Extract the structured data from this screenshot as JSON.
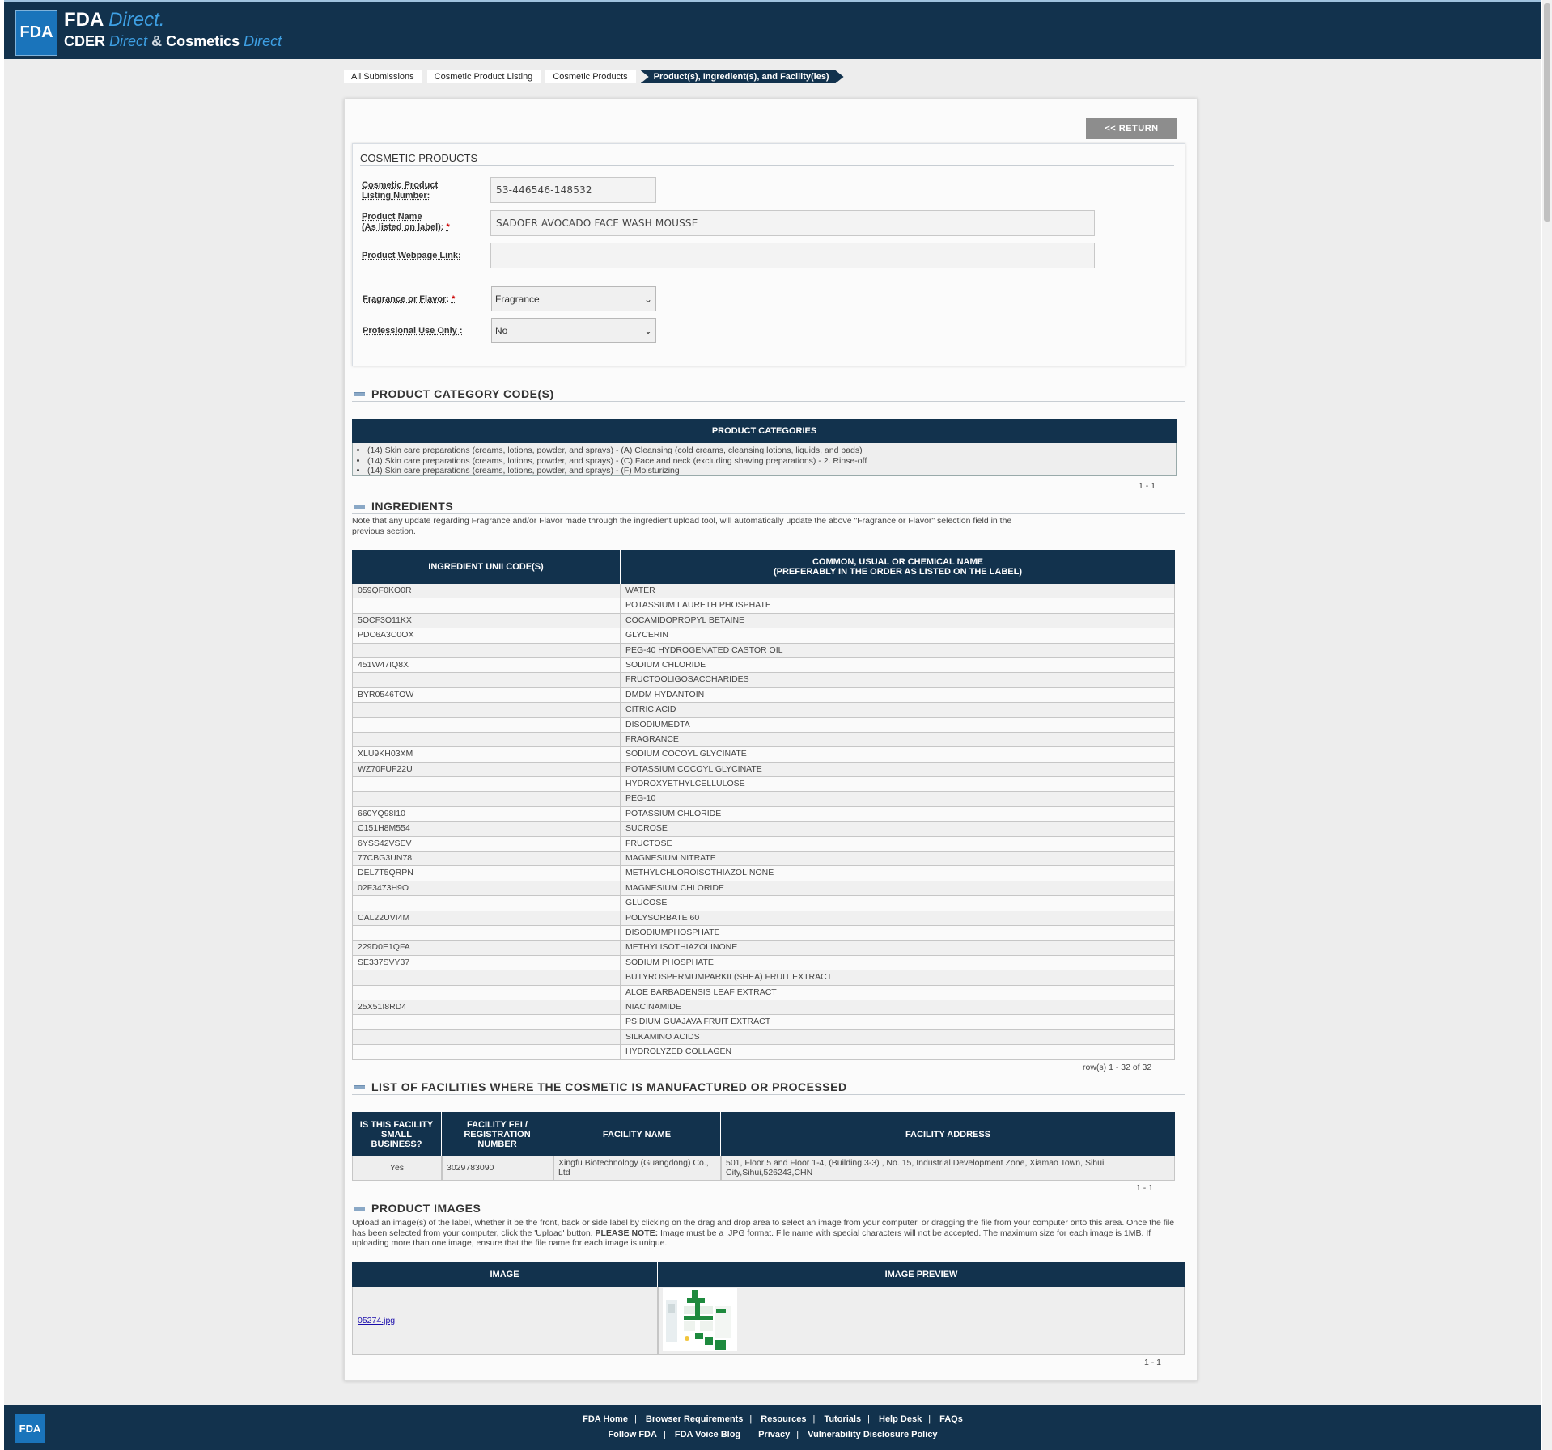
{
  "header": {
    "logo_mark": "FDA",
    "title_main": "FDA",
    "title_direct": "Direct.",
    "subtitle_cder": "CDER",
    "subtitle_direct1": "Direct",
    "subtitle_amp": "&",
    "subtitle_cosmetics": "Cosmetics",
    "subtitle_direct2": "Direct"
  },
  "breadcrumb": [
    "All Submissions",
    "Cosmetic Product Listing",
    "Cosmetic Products",
    "Product(s), Ingredient(s), and Facility(ies)"
  ],
  "return_button": "<< RETURN",
  "cosmetic_products": {
    "title": "COSMETIC PRODUCTS",
    "listing_label_1": "Cosmetic Product",
    "listing_label_2": "Listing Number:",
    "listing_value": "53-446546-148532",
    "name_label_1": "Product Name",
    "name_label_2": "(As listed on label):",
    "name_value": "SADOER AVOCADO FACE WASH MOUSSE",
    "webpage_label": "Product Webpage Link:",
    "webpage_value": "",
    "fragrance_label": "Fragrance or Flavor:",
    "fragrance_value": "Fragrance",
    "professional_label": "Professional Use Only :",
    "professional_value": "No",
    "required_mark": "*"
  },
  "categories": {
    "section_title": "PRODUCT CATEGORY CODE(S)",
    "header": "PRODUCT CATEGORIES",
    "items": [
      "(14) Skin care preparations (creams, lotions, powder, and sprays) - (A) Cleansing (cold creams, cleansing lotions, liquids, and pads)",
      "(14) Skin care preparations (creams, lotions, powder, and sprays) - (C) Face and neck (excluding shaving preparations) - 2. Rinse-off",
      "(14) Skin care preparations (creams, lotions, powder, and sprays) - (F) Moisturizing"
    ],
    "pager": "1 - 1"
  },
  "ingredients": {
    "section_title": "INGREDIENTS",
    "note": "Note that any update regarding Fragrance and/or Flavor made through the ingredient upload tool, will automatically update the above \"Fragrance or Flavor\" selection field in the previous section.",
    "col1": "INGREDIENT UNII CODE(S)",
    "col2_line1": "COMMON, USUAL OR CHEMICAL NAME",
    "col2_line2": "(PREFERABLY IN THE ORDER AS LISTED ON THE LABEL)",
    "rows": [
      [
        "059QF0KO0R",
        "WATER"
      ],
      [
        "",
        "POTASSIUM LAURETH PHOSPHATE"
      ],
      [
        "5OCF3O11KX",
        "COCAMIDOPROPYL BETAINE"
      ],
      [
        "PDC6A3C0OX",
        "GLYCERIN"
      ],
      [
        "",
        "PEG-40 HYDROGENATED CASTOR OIL"
      ],
      [
        "451W47IQ8X",
        "SODIUM CHLORIDE"
      ],
      [
        "",
        "FRUCTOOLIGOSACCHARIDES"
      ],
      [
        "BYR0546TOW",
        "DMDM HYDANTOIN"
      ],
      [
        "",
        "CITRIC ACID"
      ],
      [
        "",
        "DISODIUMEDTA"
      ],
      [
        "",
        "FRAGRANCE"
      ],
      [
        "XLU9KH03XM",
        "SODIUM COCOYL GLYCINATE"
      ],
      [
        "WZ70FUF22U",
        "POTASSIUM COCOYL GLYCINATE"
      ],
      [
        "",
        "HYDROXYETHYLCELLULOSE"
      ],
      [
        "",
        "PEG-10"
      ],
      [
        "660YQ98I10",
        "POTASSIUM CHLORIDE"
      ],
      [
        "C151H8M554",
        "SUCROSE"
      ],
      [
        "6YSS42VSEV",
        "FRUCTOSE"
      ],
      [
        "77CBG3UN78",
        "MAGNESIUM NITRATE"
      ],
      [
        "DEL7T5QRPN",
        "METHYLCHLOROISOTHIAZOLINONE"
      ],
      [
        "02F3473H9O",
        "MAGNESIUM CHLORIDE"
      ],
      [
        "",
        "GLUCOSE"
      ],
      [
        "CAL22UVI4M",
        "POLYSORBATE 60"
      ],
      [
        "",
        "DISODIUMPHOSPHATE"
      ],
      [
        "229D0E1QFA",
        "METHYLISOTHIAZOLINONE"
      ],
      [
        "SE337SVY37",
        "SODIUM PHOSPHATE"
      ],
      [
        "",
        "BUTYROSPERMUMPARKII (SHEA) FRUIT EXTRACT"
      ],
      [
        "",
        "ALOE BARBADENSIS LEAF EXTRACT"
      ],
      [
        "25X51I8RD4",
        "NIACINAMIDE"
      ],
      [
        "",
        "PSIDIUM GUAJAVA FRUIT EXTRACT"
      ],
      [
        "",
        "SILKAMINO ACIDS"
      ],
      [
        "",
        "HYDROLYZED COLLAGEN"
      ]
    ],
    "pager": "row(s) 1 - 32 of 32"
  },
  "facilities": {
    "section_title": "LIST OF FACILITIES WHERE THE COSMETIC IS MANUFACTURED OR PROCESSED",
    "col1": "IS THIS FACILITY SMALL BUSINESS?",
    "col2": "FACILITY FEI / REGISTRATION NUMBER",
    "col3": "FACILITY NAME",
    "col4": "FACILITY ADDRESS",
    "row": {
      "small_business": "Yes",
      "fei": "3029783090",
      "name": "Xingfu Biotechnology (Guangdong) Co., Ltd",
      "address": "501, Floor 5 and Floor 1-4, (Building 3-3) , No. 15, Industrial Development Zone, Xiamao Town, Sihui City,Sihui,526243,CHN"
    },
    "pager": "1 - 1"
  },
  "images": {
    "section_title": "PRODUCT IMAGES",
    "note_a": "Upload an image(s) of the label, whether it be the front, back or side label by clicking on the drag and drop area to select an image from your computer, or dragging the file from your computer onto this area. Once the file has been selected from your computer, click the 'Upload' button.",
    "note_bold": "PLEASE NOTE:",
    "note_b": "Image must be a .JPG format. File name with special characters will not be accepted. The maximum size for each image is 1MB. If uploading more than one image, ensure that the file name for each image is unique.",
    "col1": "IMAGE",
    "col2": "IMAGE PREVIEW",
    "file_name": "05274.jpg",
    "pager": "1 - 1"
  },
  "footer": {
    "logo": "FDA",
    "row1": [
      "FDA Home",
      "Browser Requirements",
      "Resources",
      "Tutorials",
      "Help Desk",
      "FAQs"
    ],
    "row2": [
      "Follow FDA",
      "FDA Voice Blog",
      "Privacy",
      "Vulnerability Disclosure Policy"
    ],
    "separator": "|"
  },
  "colors": {
    "navy": "#12324d",
    "accent_blue": "#1a74bb",
    "return_gray": "#8d8d8d"
  }
}
